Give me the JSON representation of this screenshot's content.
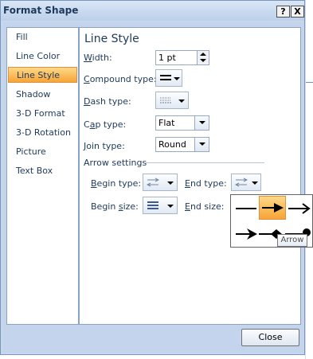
{
  "window": {
    "title": "Format Shape",
    "help_label": "?",
    "close_label": "X"
  },
  "nav": {
    "items": [
      {
        "label": "Fill"
      },
      {
        "label": "Line Color"
      },
      {
        "label": "Line Style",
        "selected": true
      },
      {
        "label": "Shadow"
      },
      {
        "label": "3-D Format"
      },
      {
        "label": "3-D Rotation"
      },
      {
        "label": "Picture"
      },
      {
        "label": "Text Box"
      }
    ]
  },
  "line_style": {
    "heading": "Line Style",
    "width": {
      "label_u": "W",
      "label_rest": "idth:",
      "value": "1 pt"
    },
    "compound_type": {
      "label_u": "C",
      "label_rest": "ompound type:",
      "icon": "compound-lines-icon"
    },
    "dash_type": {
      "label_u": "D",
      "label_rest": "ash type:",
      "icon": "dash-lines-icon"
    },
    "cap_type": {
      "label_pre": "C",
      "label_u": "a",
      "label_rest": "p type:",
      "value": "Flat"
    },
    "join_type": {
      "label_u": "J",
      "label_rest": "oin type:",
      "value": "Round"
    }
  },
  "arrow_settings": {
    "heading": "Arrow settings",
    "begin_type": {
      "label_u": "B",
      "label_rest": "egin type:",
      "icon": "arrow-type-icon"
    },
    "end_type": {
      "label_u": "E",
      "label_rest": "nd type:",
      "icon": "arrow-type-icon"
    },
    "begin_size": {
      "label_pre": "Begin ",
      "label_u": "s",
      "label_rest": "ize:",
      "icon": "arrow-size-icon"
    },
    "end_size": {
      "label_pre": "",
      "label_u": "E",
      "label_rest": "nd size:"
    }
  },
  "arrow_popup": {
    "options": [
      "no-arrow",
      "arrow",
      "open-arrow",
      "stealth-arrow",
      "diamond-arrow",
      "oval-arrow"
    ],
    "selected": "arrow",
    "tooltip": "Arrow"
  },
  "footer": {
    "close_label": "Close"
  },
  "colors": {
    "accent": "#f7a436",
    "dialog_bg": "#c3d4ec",
    "text": "#1e395b"
  }
}
